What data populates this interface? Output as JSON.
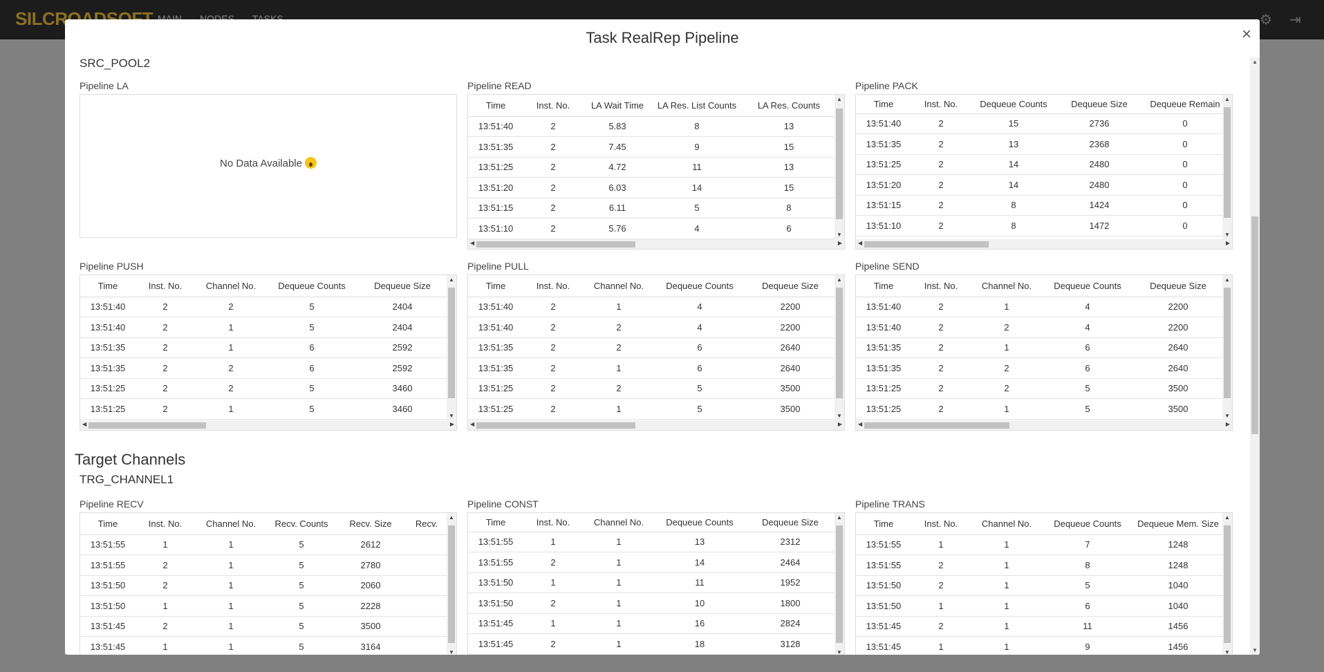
{
  "app": {
    "logo": "SILCROADSOFT",
    "nav": [
      "MAIN",
      "NODES",
      "TASKS"
    ]
  },
  "modal": {
    "title": "Task RealRep Pipeline",
    "close": "×"
  },
  "source": {
    "pool": "SRC_POOL2",
    "la": {
      "label": "Pipeline LA",
      "empty": "No Data Available"
    },
    "read": {
      "label": "Pipeline READ",
      "columns": [
        "Time",
        "Inst. No.",
        "LA Wait Time",
        "LA Res. List Counts",
        "LA Res. Counts"
      ],
      "rows": [
        [
          "13:51:40",
          "2",
          "5.83",
          "8",
          "13"
        ],
        [
          "13:51:35",
          "2",
          "7.45",
          "9",
          "15"
        ],
        [
          "13:51:25",
          "2",
          "4.72",
          "11",
          "13"
        ],
        [
          "13:51:20",
          "2",
          "6.03",
          "14",
          "15"
        ],
        [
          "13:51:15",
          "2",
          "6.11",
          "5",
          "8"
        ],
        [
          "13:51:10",
          "2",
          "5.76",
          "4",
          "6"
        ]
      ]
    },
    "pack": {
      "label": "Pipeline PACK",
      "columns": [
        "Time",
        "Inst. No.",
        "Dequeue Counts",
        "Dequeue Size",
        "Dequeue Remain"
      ],
      "rows": [
        [
          "13:51:40",
          "2",
          "15",
          "2736",
          "0"
        ],
        [
          "13:51:35",
          "2",
          "13",
          "2368",
          "0"
        ],
        [
          "13:51:25",
          "2",
          "14",
          "2480",
          "0"
        ],
        [
          "13:51:20",
          "2",
          "14",
          "2480",
          "0"
        ],
        [
          "13:51:15",
          "2",
          "8",
          "1424",
          "0"
        ],
        [
          "13:51:10",
          "2",
          "8",
          "1472",
          "0"
        ]
      ]
    },
    "push": {
      "label": "Pipeline PUSH",
      "columns": [
        "Time",
        "Inst. No.",
        "Channel No.",
        "Dequeue Counts",
        "Dequeue Size"
      ],
      "rows": [
        [
          "13:51:40",
          "2",
          "2",
          "5",
          "2404"
        ],
        [
          "13:51:40",
          "2",
          "1",
          "5",
          "2404"
        ],
        [
          "13:51:35",
          "2",
          "1",
          "6",
          "2592"
        ],
        [
          "13:51:35",
          "2",
          "2",
          "6",
          "2592"
        ],
        [
          "13:51:25",
          "2",
          "2",
          "5",
          "3460"
        ],
        [
          "13:51:25",
          "2",
          "1",
          "5",
          "3460"
        ]
      ]
    },
    "pull": {
      "label": "Pipeline PULL",
      "columns": [
        "Time",
        "Inst. No.",
        "Channel No.",
        "Dequeue Counts",
        "Dequeue Size"
      ],
      "rows": [
        [
          "13:51:40",
          "2",
          "1",
          "4",
          "2200"
        ],
        [
          "13:51:40",
          "2",
          "2",
          "4",
          "2200"
        ],
        [
          "13:51:35",
          "2",
          "2",
          "6",
          "2640"
        ],
        [
          "13:51:35",
          "2",
          "1",
          "6",
          "2640"
        ],
        [
          "13:51:25",
          "2",
          "2",
          "5",
          "3500"
        ],
        [
          "13:51:25",
          "2",
          "1",
          "5",
          "3500"
        ]
      ]
    },
    "send": {
      "label": "Pipeline SEND",
      "columns": [
        "Time",
        "Inst. No.",
        "Channel No.",
        "Dequeue Counts",
        "Dequeue Size"
      ],
      "rows": [
        [
          "13:51:40",
          "2",
          "1",
          "4",
          "2200"
        ],
        [
          "13:51:40",
          "2",
          "2",
          "4",
          "2200"
        ],
        [
          "13:51:35",
          "2",
          "1",
          "6",
          "2640"
        ],
        [
          "13:51:35",
          "2",
          "2",
          "6",
          "2640"
        ],
        [
          "13:51:25",
          "2",
          "2",
          "5",
          "3500"
        ],
        [
          "13:51:25",
          "2",
          "1",
          "5",
          "3500"
        ]
      ]
    }
  },
  "target": {
    "section": "Target Channels",
    "channel": "TRG_CHANNEL1",
    "recv": {
      "label": "Pipeline RECV",
      "columns": [
        "Time",
        "Inst. No.",
        "Channel No.",
        "Recv. Counts",
        "Recv. Size",
        "Recv."
      ],
      "rows": [
        [
          "13:51:55",
          "1",
          "1",
          "5",
          "2612",
          ""
        ],
        [
          "13:51:55",
          "2",
          "1",
          "5",
          "2780",
          ""
        ],
        [
          "13:51:50",
          "2",
          "1",
          "5",
          "2060",
          ""
        ],
        [
          "13:51:50",
          "1",
          "1",
          "5",
          "2228",
          ""
        ],
        [
          "13:51:45",
          "2",
          "1",
          "5",
          "3500",
          ""
        ],
        [
          "13:51:45",
          "1",
          "1",
          "5",
          "3164",
          ""
        ]
      ]
    },
    "const": {
      "label": "Pipeline CONST",
      "columns": [
        "Time",
        "Inst. No.",
        "Channel No.",
        "Dequeue Counts",
        "Dequeue Size"
      ],
      "rows": [
        [
          "13:51:55",
          "1",
          "1",
          "13",
          "2312"
        ],
        [
          "13:51:55",
          "2",
          "1",
          "14",
          "2464"
        ],
        [
          "13:51:50",
          "1",
          "1",
          "11",
          "1952"
        ],
        [
          "13:51:50",
          "2",
          "1",
          "10",
          "1800"
        ],
        [
          "13:51:45",
          "1",
          "1",
          "16",
          "2824"
        ],
        [
          "13:51:45",
          "2",
          "1",
          "18",
          "3128"
        ]
      ]
    },
    "trans": {
      "label": "Pipeline TRANS",
      "columns": [
        "Time",
        "Inst. No.",
        "Channel No.",
        "Dequeue Counts",
        "Dequeue Mem. Size"
      ],
      "rows": [
        [
          "13:51:55",
          "1",
          "1",
          "7",
          "1248"
        ],
        [
          "13:51:55",
          "2",
          "1",
          "8",
          "1248"
        ],
        [
          "13:51:50",
          "2",
          "1",
          "5",
          "1040"
        ],
        [
          "13:51:50",
          "1",
          "1",
          "6",
          "1040"
        ],
        [
          "13:51:45",
          "2",
          "1",
          "11",
          "1456"
        ],
        [
          "13:51:45",
          "1",
          "1",
          "9",
          "1456"
        ]
      ]
    }
  }
}
